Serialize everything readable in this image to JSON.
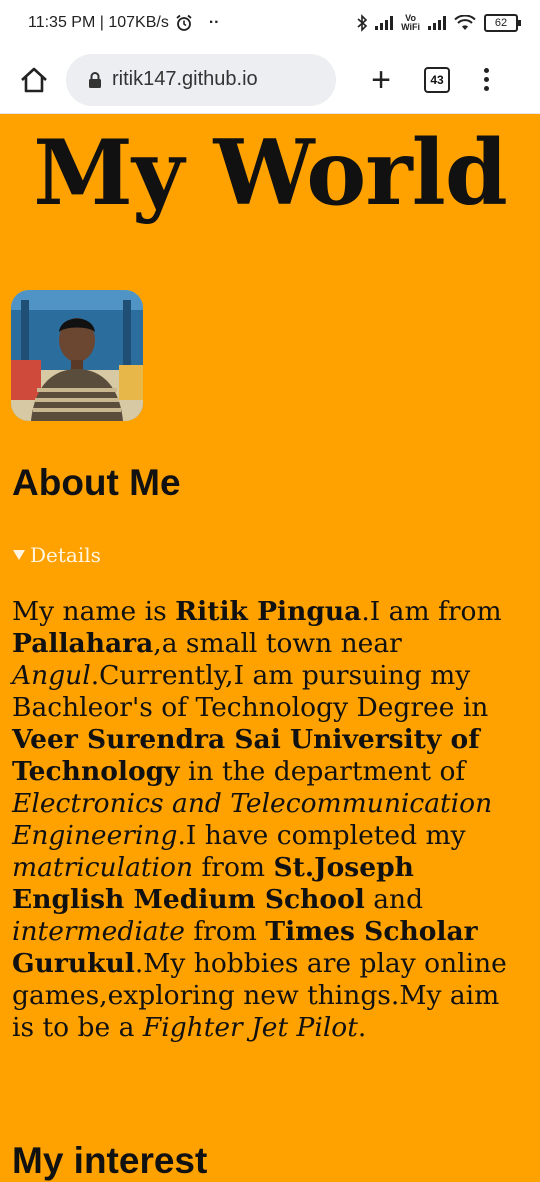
{
  "status_bar": {
    "time_speed": "11:35 PM | 107KB/s",
    "dots": "··",
    "volte": "Vo\nWiFi",
    "battery": "62"
  },
  "browser": {
    "url": "ritik147.github.io",
    "new_tab": "+",
    "tab_count": "43"
  },
  "page": {
    "title": "My World",
    "about_heading": "About Me",
    "details_label": "Details",
    "about": {
      "p1": "My name is ",
      "name": "Ritik Pingua",
      "p2": ".I am from ",
      "town": "Pallahara",
      "p3": ",a small town near ",
      "near": "Angul",
      "p4": ".Currently,I am pursuing my Bachleor's of Technology Degree in ",
      "university": "Veer Surendra Sai University of Technology",
      "p5": " in the department of ",
      "department": "Electronics and Telecommunication Engineering",
      "p6": ".I have completed my ",
      "matric": "matriculation",
      "p7": " from ",
      "school": "St.Joseph English Medium School",
      "p8": " and ",
      "inter": "intermediate",
      "p9": " from ",
      "college": "Times Scholar Gurukul",
      "p10": ".My hobbies are play online games,exploring new things.My aim is to be a ",
      "aim": "Fighter Jet Pilot",
      "p11": "."
    },
    "interest_heading": "My interest"
  }
}
